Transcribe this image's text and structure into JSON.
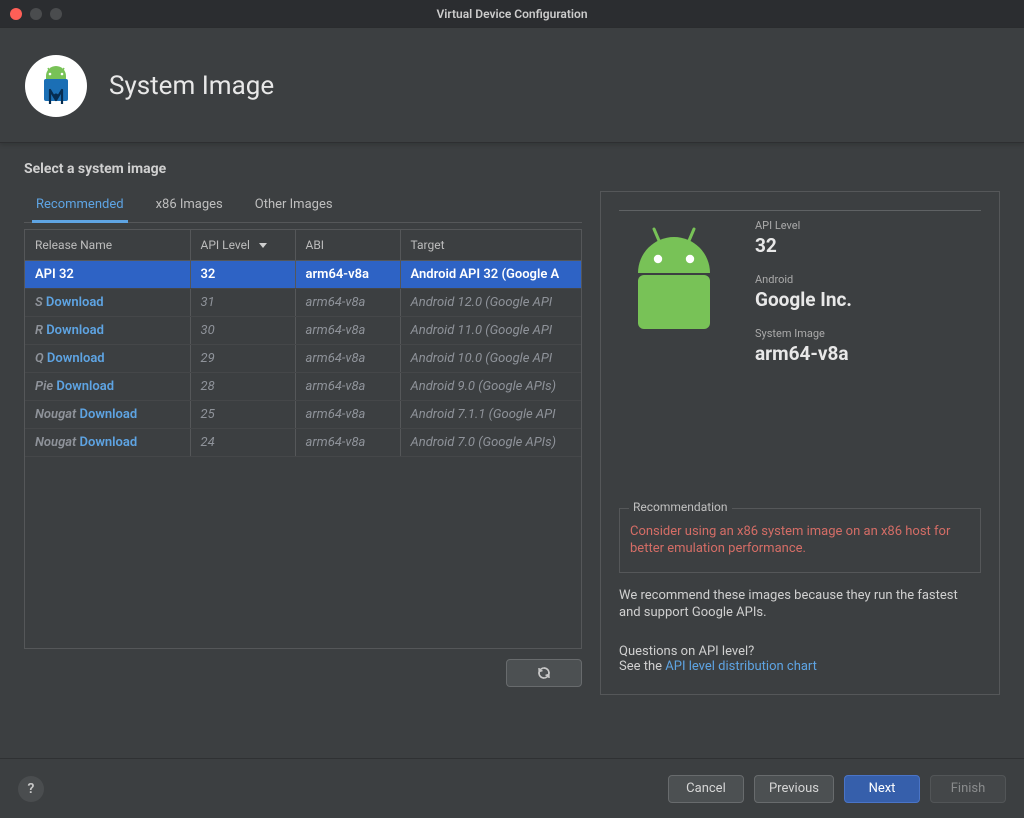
{
  "window": {
    "title": "Virtual Device Configuration"
  },
  "banner": {
    "title": "System Image"
  },
  "subhead": "Select a system image",
  "tabs": [
    {
      "label": "Recommended",
      "active": true
    },
    {
      "label": "x86 Images",
      "active": false
    },
    {
      "label": "Other Images",
      "active": false
    }
  ],
  "table": {
    "columns": {
      "release_name": "Release Name",
      "api_level": "API Level",
      "abi": "ABI",
      "target": "Target"
    },
    "rows": [
      {
        "release": "API 32",
        "dl": null,
        "api": "32",
        "abi": "arm64-v8a",
        "target": "Android API 32 (Google A",
        "selected": true
      },
      {
        "release": "S",
        "dl": "Download",
        "api": "31",
        "abi": "arm64-v8a",
        "target": "Android 12.0 (Google API",
        "selected": false
      },
      {
        "release": "R",
        "dl": "Download",
        "api": "30",
        "abi": "arm64-v8a",
        "target": "Android 11.0 (Google API",
        "selected": false
      },
      {
        "release": "Q",
        "dl": "Download",
        "api": "29",
        "abi": "arm64-v8a",
        "target": "Android 10.0 (Google API",
        "selected": false
      },
      {
        "release": "Pie",
        "dl": "Download",
        "api": "28",
        "abi": "arm64-v8a",
        "target": "Android 9.0 (Google APIs)",
        "selected": false
      },
      {
        "release": "Nougat",
        "dl": "Download",
        "api": "25",
        "abi": "arm64-v8a",
        "target": "Android 7.1.1 (Google API",
        "selected": false
      },
      {
        "release": "Nougat",
        "dl": "Download",
        "api": "24",
        "abi": "arm64-v8a",
        "target": "Android 7.0 (Google APIs)",
        "selected": false
      }
    ]
  },
  "right": {
    "api_label": "API Level",
    "api_value": "32",
    "vendor_label": "Android",
    "vendor_value": "Google Inc.",
    "system_image_label": "System Image",
    "system_image_value": "arm64-v8a",
    "rec_title": "Recommendation",
    "rec_body": "Consider using an x86 system image on an x86 host for better emulation performance.",
    "note": "We recommend these images because they run the fastest and support Google APIs.",
    "question": "Questions on API level?",
    "see_the": "See the ",
    "chart_link": "API level distribution chart"
  },
  "footer": {
    "help": "?",
    "cancel": "Cancel",
    "previous": "Previous",
    "next": "Next",
    "finish": "Finish"
  }
}
